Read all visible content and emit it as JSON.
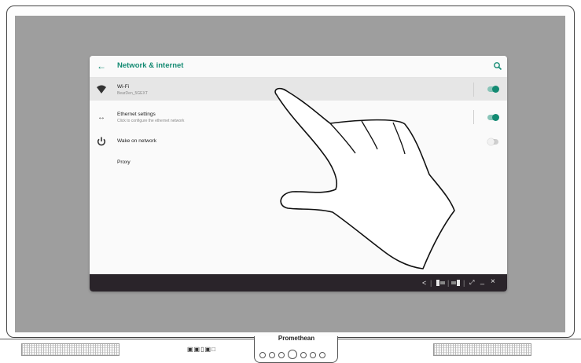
{
  "device": {
    "brand": "Promethean"
  },
  "app": {
    "title": "Network & internet",
    "back_icon": "arrow-left-icon",
    "search_icon": "search-icon",
    "accent": "#138a72"
  },
  "settings": {
    "wifi": {
      "label": "Wi-Fi",
      "sublabel": "BearDen_5GEXT",
      "icon": "wifi-icon",
      "enabled": true
    },
    "ethernet": {
      "label": "Ethernet settings",
      "sublabel": "Click to configure the ethernet network",
      "icon": "ethernet-icon",
      "enabled": true
    },
    "wake": {
      "label": "Wake on network",
      "icon": "power-icon",
      "enabled": false
    },
    "proxy": {
      "label": "Proxy"
    }
  },
  "navbar": {
    "back_symbol": "<",
    "minimize_symbol": "_",
    "close_symbol": "×"
  }
}
